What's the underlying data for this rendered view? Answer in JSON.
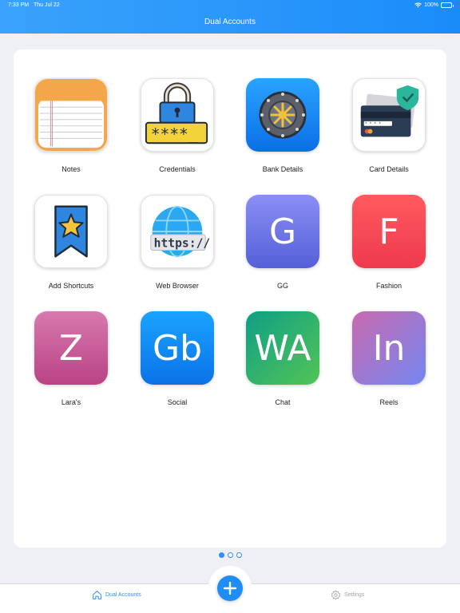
{
  "status_bar": {
    "time": "7:33 PM",
    "date": "Thu Jul 22",
    "battery": "100%"
  },
  "header": {
    "title": "Dual Accounts"
  },
  "apps": [
    {
      "label": "Notes",
      "icon": "notes-icon"
    },
    {
      "label": "Credentials",
      "icon": "lock-password-icon"
    },
    {
      "label": "Bank Details",
      "icon": "vault-icon"
    },
    {
      "label": "Card Details",
      "icon": "credit-card-icon"
    },
    {
      "label": "Add Shortcuts",
      "icon": "bookmark-star-icon"
    },
    {
      "label": "Web Browser",
      "icon": "globe-https-icon"
    },
    {
      "label": "GG",
      "letter": "G",
      "color_from": "#8a8ff5",
      "color_to": "#5560d8"
    },
    {
      "label": "Fashion",
      "letter": "F",
      "color_from": "#ff5a5f",
      "color_to": "#ee3a4e"
    },
    {
      "label": "Lara's",
      "letter": "Z",
      "color_from": "#d879b0",
      "color_to": "#b94383"
    },
    {
      "label": "Social",
      "letter": "Gb",
      "color_from": "#1aa3ff",
      "color_to": "#0a73e8"
    },
    {
      "label": "Chat",
      "letter": "WA",
      "color_from": "#12a582",
      "color_to": "#4bc15a"
    },
    {
      "label": "Reels",
      "letter": "In",
      "color_from": "#c46ab5",
      "color_to": "#7c86ee"
    }
  ],
  "pager": {
    "pages": 3,
    "current": 1
  },
  "tabbar": {
    "home_label": "Dual Accounts",
    "settings_label": "Settings"
  },
  "colors": {
    "accent": "#1e8df5",
    "header": "#2196fa"
  }
}
